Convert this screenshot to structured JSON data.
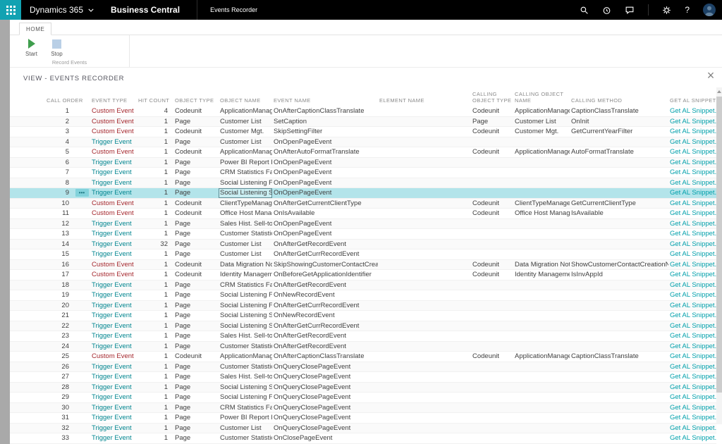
{
  "topbar": {
    "brand": "Dynamics 365",
    "product": "Business Central",
    "page_tab": "Events Recorder",
    "help_glyph": "?",
    "icons": [
      "search-icon",
      "alarm-icon",
      "feedback-icon",
      "settings-icon",
      "help-icon",
      "avatar"
    ]
  },
  "ribbon": {
    "tab_home": "HOME",
    "start_label": "Start",
    "stop_label": "Stop",
    "group_label": "Record Events"
  },
  "view_header": {
    "title": "VIEW - EVENTS RECORDER",
    "close_glyph": "×"
  },
  "colors": {
    "accent_teal": "#12a2b2",
    "custom_event": "#a4262c",
    "trigger_event": "#00858f",
    "snippet_link": "#00a0ab",
    "selected_row_bg": "#b3e4ea",
    "start_icon_green": "#3f9e4d",
    "stop_icon_blue": "#b9cfe6"
  },
  "table": {
    "columns": [
      "CALL ORDER",
      "EVENT TYPE",
      "HIT COUNT",
      "OBJECT TYPE",
      "OBJECT NAME",
      "EVENT NAME",
      "ELEMENT NAME",
      "CALLING OBJECT TYPE",
      "CALLING OBJECT NAME",
      "CALLING METHOD",
      "GET AL SNIPPET"
    ],
    "link_label": "Get AL Snippet.",
    "row_menu_glyph": "•••",
    "selected_index": 8,
    "rows": [
      {
        "call_order": "1",
        "event_type": "Custom Event",
        "hit_count": "4",
        "object_type": "Codeunit",
        "object_name": "ApplicationManagem...",
        "event_name": "OnAfterCaptionClassTranslate",
        "element_name": "",
        "calling_object_type": "Codeunit",
        "calling_object_name": "ApplicationManagem...",
        "calling_method": "CaptionClassTranslate"
      },
      {
        "call_order": "2",
        "event_type": "Custom Event",
        "hit_count": "1",
        "object_type": "Page",
        "object_name": "Customer List",
        "event_name": "SetCaption",
        "element_name": "",
        "calling_object_type": "Page",
        "calling_object_name": "Customer List",
        "calling_method": "OnInit"
      },
      {
        "call_order": "3",
        "event_type": "Custom Event",
        "hit_count": "1",
        "object_type": "Codeunit",
        "object_name": "Customer Mgt.",
        "event_name": "SkipSettingFilter",
        "element_name": "",
        "calling_object_type": "Codeunit",
        "calling_object_name": "Customer Mgt.",
        "calling_method": "GetCurrentYearFilter"
      },
      {
        "call_order": "4",
        "event_type": "Trigger Event",
        "hit_count": "1",
        "object_type": "Page",
        "object_name": "Customer List",
        "event_name": "OnOpenPageEvent",
        "element_name": "",
        "calling_object_type": "",
        "calling_object_name": "",
        "calling_method": ""
      },
      {
        "call_order": "5",
        "event_type": "Custom Event",
        "hit_count": "1",
        "object_type": "Codeunit",
        "object_name": "ApplicationManagem...",
        "event_name": "OnAfterAutoFormatTranslate",
        "element_name": "",
        "calling_object_type": "Codeunit",
        "calling_object_name": "ApplicationManagem...",
        "calling_method": "AutoFormatTranslate"
      },
      {
        "call_order": "6",
        "event_type": "Trigger Event",
        "hit_count": "1",
        "object_type": "Page",
        "object_name": "Power BI Report Fact...",
        "event_name": "OnOpenPageEvent",
        "element_name": "",
        "calling_object_type": "",
        "calling_object_name": "",
        "calling_method": ""
      },
      {
        "call_order": "7",
        "event_type": "Trigger Event",
        "hit_count": "1",
        "object_type": "Page",
        "object_name": "CRM Statistics FactBox",
        "event_name": "OnOpenPageEvent",
        "element_name": "",
        "calling_object_type": "",
        "calling_object_name": "",
        "calling_method": ""
      },
      {
        "call_order": "8",
        "event_type": "Trigger Event",
        "hit_count": "1",
        "object_type": "Page",
        "object_name": "Social Listening FactB...",
        "event_name": "OnOpenPageEvent",
        "element_name": "",
        "calling_object_type": "",
        "calling_object_name": "",
        "calling_method": ""
      },
      {
        "call_order": "9",
        "event_type": "Trigger Event",
        "hit_count": "1",
        "object_type": "Page",
        "object_name": "Social Listening Setu...",
        "event_name": "OnOpenPageEvent",
        "element_name": "",
        "calling_object_type": "",
        "calling_object_name": "",
        "calling_method": ""
      },
      {
        "call_order": "10",
        "event_type": "Custom Event",
        "hit_count": "1",
        "object_type": "Codeunit",
        "object_name": "ClientTypeManageme...",
        "event_name": "OnAfterGetCurrentClientType",
        "element_name": "",
        "calling_object_type": "Codeunit",
        "calling_object_name": "ClientTypeManageme...",
        "calling_method": "GetCurrentClientType"
      },
      {
        "call_order": "11",
        "event_type": "Custom Event",
        "hit_count": "1",
        "object_type": "Codeunit",
        "object_name": "Office Host Manage...",
        "event_name": "OnIsAvailable",
        "element_name": "",
        "calling_object_type": "Codeunit",
        "calling_object_name": "Office Host Manage...",
        "calling_method": "IsAvailable"
      },
      {
        "call_order": "12",
        "event_type": "Trigger Event",
        "hit_count": "1",
        "object_type": "Page",
        "object_name": "Sales Hist. Sell-to Fact...",
        "event_name": "OnOpenPageEvent",
        "element_name": "",
        "calling_object_type": "",
        "calling_object_name": "",
        "calling_method": ""
      },
      {
        "call_order": "13",
        "event_type": "Trigger Event",
        "hit_count": "1",
        "object_type": "Page",
        "object_name": "Customer Statistics Fa...",
        "event_name": "OnOpenPageEvent",
        "element_name": "",
        "calling_object_type": "",
        "calling_object_name": "",
        "calling_method": ""
      },
      {
        "call_order": "14",
        "event_type": "Trigger Event",
        "hit_count": "32",
        "object_type": "Page",
        "object_name": "Customer List",
        "event_name": "OnAfterGetRecordEvent",
        "element_name": "",
        "calling_object_type": "",
        "calling_object_name": "",
        "calling_method": ""
      },
      {
        "call_order": "15",
        "event_type": "Trigger Event",
        "hit_count": "1",
        "object_type": "Page",
        "object_name": "Customer List",
        "event_name": "OnAfterGetCurrRecordEvent",
        "element_name": "",
        "calling_object_type": "",
        "calling_object_name": "",
        "calling_method": ""
      },
      {
        "call_order": "16",
        "event_type": "Custom Event",
        "hit_count": "1",
        "object_type": "Codeunit",
        "object_name": "Data Migration Notifier",
        "event_name": "SkipShowingCustomerContactCreation...",
        "element_name": "",
        "calling_object_type": "Codeunit",
        "calling_object_name": "Data Migration Notifier",
        "calling_method": "ShowCustomerContactCreationNotificat..."
      },
      {
        "call_order": "17",
        "event_type": "Custom Event",
        "hit_count": "1",
        "object_type": "Codeunit",
        "object_name": "Identity Management",
        "event_name": "OnBeforeGetApplicationIdentifier",
        "element_name": "",
        "calling_object_type": "Codeunit",
        "calling_object_name": "Identity Management",
        "calling_method": "IsInvAppId"
      },
      {
        "call_order": "18",
        "event_type": "Trigger Event",
        "hit_count": "1",
        "object_type": "Page",
        "object_name": "CRM Statistics FactBox",
        "event_name": "OnAfterGetRecordEvent",
        "element_name": "",
        "calling_object_type": "",
        "calling_object_name": "",
        "calling_method": ""
      },
      {
        "call_order": "19",
        "event_type": "Trigger Event",
        "hit_count": "1",
        "object_type": "Page",
        "object_name": "Social Listening FactB...",
        "event_name": "OnNewRecordEvent",
        "element_name": "",
        "calling_object_type": "",
        "calling_object_name": "",
        "calling_method": ""
      },
      {
        "call_order": "20",
        "event_type": "Trigger Event",
        "hit_count": "1",
        "object_type": "Page",
        "object_name": "Social Listening FactB...",
        "event_name": "OnAfterGetCurrRecordEvent",
        "element_name": "",
        "calling_object_type": "",
        "calling_object_name": "",
        "calling_method": ""
      },
      {
        "call_order": "21",
        "event_type": "Trigger Event",
        "hit_count": "1",
        "object_type": "Page",
        "object_name": "Social Listening Setu...",
        "event_name": "OnNewRecordEvent",
        "element_name": "",
        "calling_object_type": "",
        "calling_object_name": "",
        "calling_method": ""
      },
      {
        "call_order": "22",
        "event_type": "Trigger Event",
        "hit_count": "1",
        "object_type": "Page",
        "object_name": "Social Listening Setu...",
        "event_name": "OnAfterGetCurrRecordEvent",
        "element_name": "",
        "calling_object_type": "",
        "calling_object_name": "",
        "calling_method": ""
      },
      {
        "call_order": "23",
        "event_type": "Trigger Event",
        "hit_count": "1",
        "object_type": "Page",
        "object_name": "Sales Hist. Sell-to Fact...",
        "event_name": "OnAfterGetRecordEvent",
        "element_name": "",
        "calling_object_type": "",
        "calling_object_name": "",
        "calling_method": ""
      },
      {
        "call_order": "24",
        "event_type": "Trigger Event",
        "hit_count": "1",
        "object_type": "Page",
        "object_name": "Customer Statistics Fa...",
        "event_name": "OnAfterGetRecordEvent",
        "element_name": "",
        "calling_object_type": "",
        "calling_object_name": "",
        "calling_method": ""
      },
      {
        "call_order": "25",
        "event_type": "Custom Event",
        "hit_count": "1",
        "object_type": "Codeunit",
        "object_name": "ApplicationManagem...",
        "event_name": "OnAfterCaptionClassTranslate",
        "element_name": "",
        "calling_object_type": "Codeunit",
        "calling_object_name": "ApplicationManagem...",
        "calling_method": "CaptionClassTranslate"
      },
      {
        "call_order": "26",
        "event_type": "Trigger Event",
        "hit_count": "1",
        "object_type": "Page",
        "object_name": "Customer Statistics Fa...",
        "event_name": "OnQueryClosePageEvent",
        "element_name": "",
        "calling_object_type": "",
        "calling_object_name": "",
        "calling_method": ""
      },
      {
        "call_order": "27",
        "event_type": "Trigger Event",
        "hit_count": "1",
        "object_type": "Page",
        "object_name": "Sales Hist. Sell-to Fact...",
        "event_name": "OnQueryClosePageEvent",
        "element_name": "",
        "calling_object_type": "",
        "calling_object_name": "",
        "calling_method": ""
      },
      {
        "call_order": "28",
        "event_type": "Trigger Event",
        "hit_count": "1",
        "object_type": "Page",
        "object_name": "Social Listening Setu...",
        "event_name": "OnQueryClosePageEvent",
        "element_name": "",
        "calling_object_type": "",
        "calling_object_name": "",
        "calling_method": ""
      },
      {
        "call_order": "29",
        "event_type": "Trigger Event",
        "hit_count": "1",
        "object_type": "Page",
        "object_name": "Social Listening FactB...",
        "event_name": "OnQueryClosePageEvent",
        "element_name": "",
        "calling_object_type": "",
        "calling_object_name": "",
        "calling_method": ""
      },
      {
        "call_order": "30",
        "event_type": "Trigger Event",
        "hit_count": "1",
        "object_type": "Page",
        "object_name": "CRM Statistics FactBox",
        "event_name": "OnQueryClosePageEvent",
        "element_name": "",
        "calling_object_type": "",
        "calling_object_name": "",
        "calling_method": ""
      },
      {
        "call_order": "31",
        "event_type": "Trigger Event",
        "hit_count": "1",
        "object_type": "Page",
        "object_name": "Power BI Report Fact...",
        "event_name": "OnQueryClosePageEvent",
        "element_name": "",
        "calling_object_type": "",
        "calling_object_name": "",
        "calling_method": ""
      },
      {
        "call_order": "32",
        "event_type": "Trigger Event",
        "hit_count": "1",
        "object_type": "Page",
        "object_name": "Customer List",
        "event_name": "OnQueryClosePageEvent",
        "element_name": "",
        "calling_object_type": "",
        "calling_object_name": "",
        "calling_method": ""
      },
      {
        "call_order": "33",
        "event_type": "Trigger Event",
        "hit_count": "1",
        "object_type": "Page",
        "object_name": "Customer Statistics Fa...",
        "event_name": "OnClosePageEvent",
        "element_name": "",
        "calling_object_type": "",
        "calling_object_name": "",
        "calling_method": ""
      }
    ]
  }
}
